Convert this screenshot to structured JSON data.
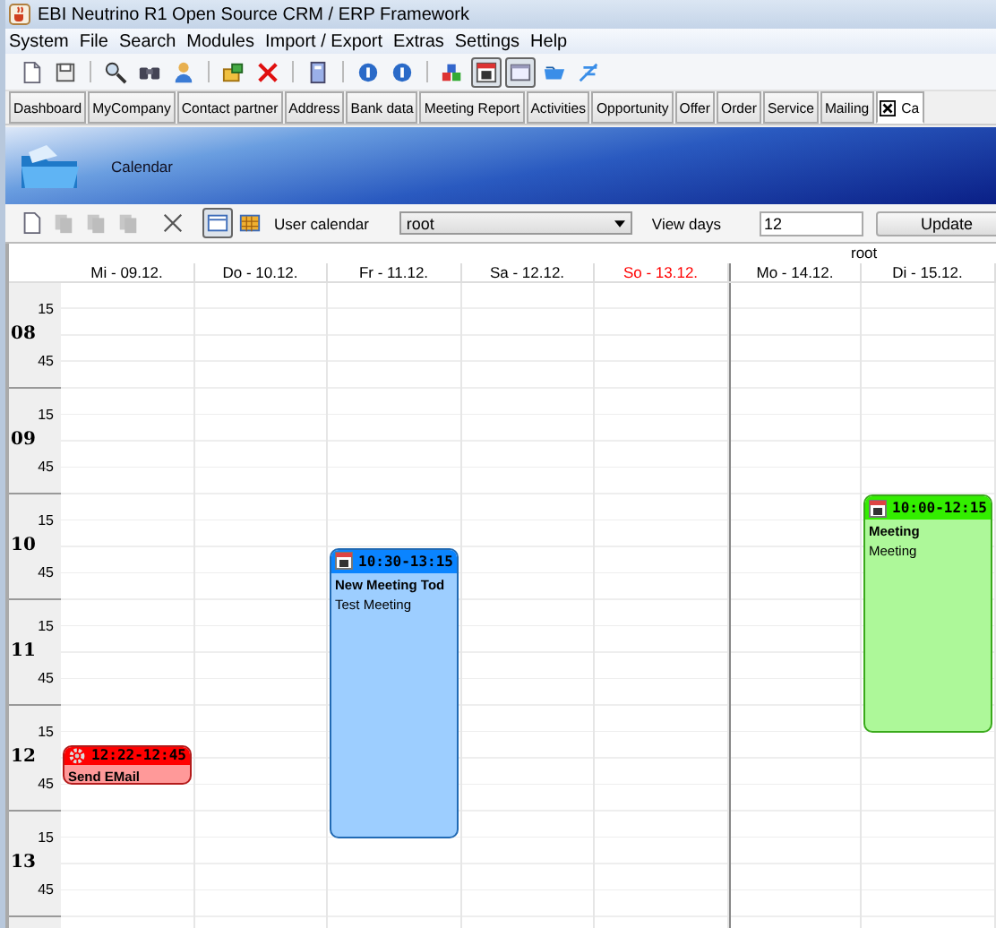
{
  "window": {
    "title": "EBI Neutrino R1 Open Source CRM / ERP Framework"
  },
  "menu": [
    "System",
    "File",
    "Search",
    "Modules",
    "Import / Export",
    "Extras",
    "Settings",
    "Help"
  ],
  "toolbar": [
    {
      "kind": "new",
      "selected": false
    },
    {
      "kind": "save",
      "selected": false
    },
    {
      "kind": "search",
      "selected": false
    },
    {
      "kind": "binoculars",
      "selected": false
    },
    {
      "kind": "user",
      "selected": false
    },
    {
      "kind": "export",
      "selected": false
    },
    {
      "kind": "delete",
      "selected": false
    },
    {
      "kind": "book",
      "selected": false
    },
    {
      "kind": "back",
      "selected": false
    },
    {
      "kind": "info",
      "selected": false
    },
    {
      "kind": "blocks",
      "selected": false
    },
    {
      "kind": "calendar",
      "selected": true
    },
    {
      "kind": "window",
      "selected": true
    },
    {
      "kind": "folder",
      "selected": false
    },
    {
      "kind": "tool",
      "selected": false
    }
  ],
  "tabs": [
    {
      "label": "Dashboard",
      "selected": false
    },
    {
      "label": "MyCompany",
      "selected": false
    },
    {
      "label": "Contact partner",
      "selected": false
    },
    {
      "label": "Address",
      "selected": false
    },
    {
      "label": "Bank data",
      "selected": false
    },
    {
      "label": "Meeting Report",
      "selected": false
    },
    {
      "label": "Activities",
      "selected": false
    },
    {
      "label": "Opportunity",
      "selected": false
    },
    {
      "label": "Offer",
      "selected": false
    },
    {
      "label": "Order",
      "selected": false
    },
    {
      "label": "Service",
      "selected": false
    },
    {
      "label": "Mailing",
      "selected": false
    },
    {
      "label": "Ca",
      "selected": true
    }
  ],
  "banner": {
    "title": "Calendar"
  },
  "calendar_toolbar": {
    "tools": [
      {
        "kind": "new",
        "disabled": false
      },
      {
        "kind": "copy",
        "disabled": true
      },
      {
        "kind": "cut",
        "disabled": true
      },
      {
        "kind": "paste",
        "disabled": true
      },
      {
        "kind": "delete",
        "disabled": false
      },
      {
        "kind": "day-view",
        "selected": true
      },
      {
        "kind": "month-view",
        "selected": false
      }
    ],
    "user_label": "User calendar",
    "user": "root",
    "days_label": "View days",
    "days": "12",
    "update": "Update"
  },
  "calendar": {
    "owner": "root",
    "hours": [
      {
        "label": "08",
        "quarters": [
          "15",
          "45"
        ]
      },
      {
        "label": "09",
        "quarters": [
          "15",
          "45"
        ]
      },
      {
        "label": "10",
        "quarters": [
          "15",
          "45"
        ]
      },
      {
        "label": "11",
        "quarters": [
          "15",
          "45"
        ]
      },
      {
        "label": "12",
        "quarters": [
          "15",
          "45"
        ]
      },
      {
        "label": "13",
        "quarters": [
          "15",
          "45"
        ]
      }
    ],
    "days": [
      {
        "label": "Mi - 09.12.",
        "color": "#000000",
        "week_start": false,
        "events": [
          {
            "kind": "task",
            "time": "12:22-12:45",
            "title": "Send EMail",
            "color": "#ff0000"
          }
        ]
      },
      {
        "label": "Do - 10.12.",
        "color": "#000000",
        "week_start": false
      },
      {
        "label": "Fr - 11.12.",
        "color": "#000000",
        "week_start": false,
        "events": [
          {
            "kind": "meeting",
            "time": "10:30-13:15",
            "title": "New Meeting Tod",
            "description": "Test Meeting",
            "color": "#0a84ff"
          }
        ]
      },
      {
        "label": "Sa - 12.12.",
        "color": "#000000",
        "week_start": false
      },
      {
        "label": "So - 13.12.",
        "color": "#ff0000",
        "week_start": false
      },
      {
        "label": "Mo - 14.12.",
        "color": "#000000",
        "week_start": true
      },
      {
        "label": "Di - 15.12.",
        "color": "#000000",
        "week_start": false,
        "events": [
          {
            "kind": "meeting",
            "time": "10:00-12:15",
            "title": "Meeting",
            "description": "Meeting",
            "color": "#33ee00"
          }
        ]
      }
    ]
  }
}
